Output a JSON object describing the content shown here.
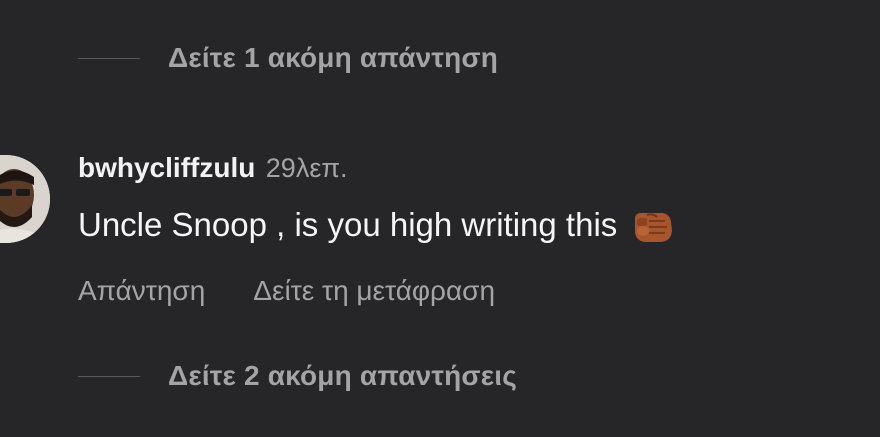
{
  "top_replies": {
    "label": "Δείτε 1 ακόμη απάντηση"
  },
  "comment": {
    "username": "bwhycliffzulu",
    "timestamp": "29λεπ.",
    "text": "Uncle Snoop , is you high writing this",
    "emoji": "oncoming-fist-icon",
    "actions": {
      "reply": "Απάντηση",
      "translate": "Δείτε τη μετάφραση"
    }
  },
  "bottom_replies": {
    "label": "Δείτε 2 ακόμη απαντήσεις"
  }
}
